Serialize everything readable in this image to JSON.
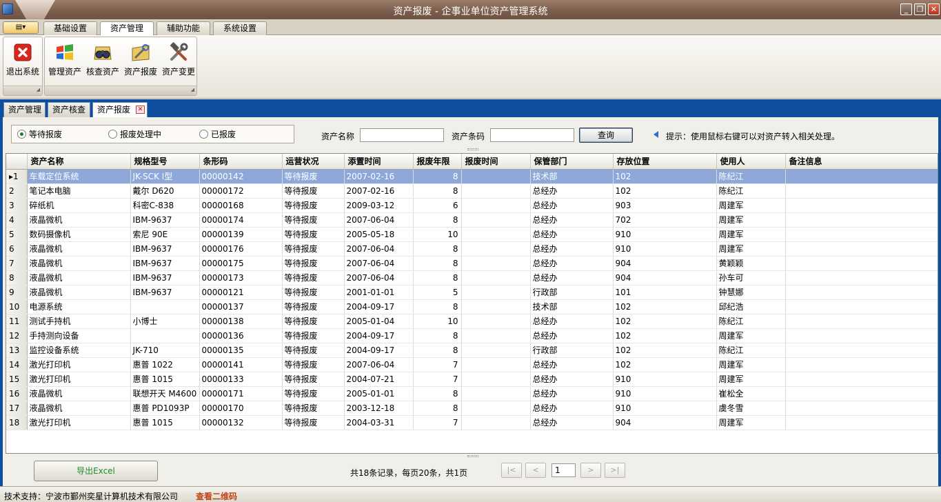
{
  "window": {
    "title": "资产报废 - 企事业单位资产管理系统"
  },
  "ribbon": {
    "menu_glyph": "▤▾",
    "tabs": [
      "基础设置",
      "资产管理",
      "辅助功能",
      "系统设置"
    ],
    "buttons": {
      "exit": "退出系统",
      "manage": "管理资产",
      "check": "核查资产",
      "scrap": "资产报废",
      "change": "资产变更"
    }
  },
  "doc_tabs": [
    "资产管理",
    "资产核查",
    "资产报废"
  ],
  "filter": {
    "radio_waiting": "等待报废",
    "radio_processing": "报废处理中",
    "radio_done": "已报废",
    "selected": "等待报废",
    "name_label": "资产名称",
    "name_value": "",
    "barcode_label": "资产条码",
    "barcode_value": "",
    "query_button": "查询",
    "hint": "提示：使用鼠标右键可以对资产转入相关处理。"
  },
  "grid": {
    "columns": [
      "资产名称",
      "规格型号",
      "条形码",
      "运营状况",
      "添置时间",
      "报废年限",
      "报废时间",
      "保管部门",
      "存放位置",
      "使用人",
      "备注信息"
    ],
    "selected_row": 1,
    "rows": [
      [
        "1",
        "车载定位系统",
        "JK-SCK Ⅰ型",
        "00000142",
        "等待报废",
        "2007-02-16",
        "8",
        "",
        "技术部",
        "102",
        "陈纪江",
        ""
      ],
      [
        "2",
        "笔记本电脑",
        "戴尔 D620",
        "00000172",
        "等待报废",
        "2007-02-16",
        "8",
        "",
        "总经办",
        "102",
        "陈纪江",
        ""
      ],
      [
        "3",
        "碎纸机",
        "科密C-838",
        "00000168",
        "等待报废",
        "2009-03-12",
        "6",
        "",
        "总经办",
        "903",
        "周建军",
        ""
      ],
      [
        "4",
        "液晶微机",
        "IBM-9637",
        "00000174",
        "等待报废",
        "2007-06-04",
        "8",
        "",
        "总经办",
        "702",
        "周建军",
        ""
      ],
      [
        "5",
        "数码摄像机",
        "索尼 90E",
        "00000139",
        "等待报废",
        "2005-05-18",
        "10",
        "",
        "总经办",
        "910",
        "周建军",
        ""
      ],
      [
        "6",
        "液晶微机",
        "IBM-9637",
        "00000176",
        "等待报废",
        "2007-06-04",
        "8",
        "",
        "总经办",
        "910",
        "周建军",
        ""
      ],
      [
        "7",
        "液晶微机",
        "IBM-9637",
        "00000175",
        "等待报废",
        "2007-06-04",
        "8",
        "",
        "总经办",
        "904",
        "黄颖颖",
        ""
      ],
      [
        "8",
        "液晶微机",
        "IBM-9637",
        "00000173",
        "等待报废",
        "2007-06-04",
        "8",
        "",
        "总经办",
        "904",
        "孙车可",
        ""
      ],
      [
        "9",
        "液晶微机",
        "IBM-9637",
        "00000121",
        "等待报废",
        "2001-01-01",
        "5",
        "",
        "行政部",
        "101",
        "钟慧娜",
        ""
      ],
      [
        "10",
        "电源系统",
        "",
        "00000137",
        "等待报废",
        "2004-09-17",
        "8",
        "",
        "技术部",
        "102",
        "邱纪浩",
        ""
      ],
      [
        "11",
        "测试手持机",
        "小博士",
        "00000138",
        "等待报废",
        "2005-01-04",
        "10",
        "",
        "总经办",
        "102",
        "陈纪江",
        ""
      ],
      [
        "12",
        "手持测向设备",
        "",
        "00000136",
        "等待报废",
        "2004-09-17",
        "8",
        "",
        "总经办",
        "102",
        "周建军",
        ""
      ],
      [
        "13",
        "监控设备系统",
        "JK-710",
        "00000135",
        "等待报废",
        "2004-09-17",
        "8",
        "",
        "行政部",
        "102",
        "陈纪江",
        ""
      ],
      [
        "14",
        "激光打印机",
        "惠普 1022",
        "00000141",
        "等待报废",
        "2007-06-04",
        "7",
        "",
        "总经办",
        "102",
        "周建军",
        ""
      ],
      [
        "15",
        "激光打印机",
        "惠普 1015",
        "00000133",
        "等待报废",
        "2004-07-21",
        "7",
        "",
        "总经办",
        "910",
        "周建军",
        ""
      ],
      [
        "16",
        "液晶微机",
        "联想开天 M4600",
        "00000171",
        "等待报废",
        "2005-01-01",
        "8",
        "",
        "总经办",
        "910",
        "崔松全",
        ""
      ],
      [
        "17",
        "液晶微机",
        "惠普 PD1093P",
        "00000170",
        "等待报废",
        "2003-12-18",
        "8",
        "",
        "总经办",
        "910",
        "虞冬雪",
        ""
      ],
      [
        "18",
        "激光打印机",
        "惠普 1015",
        "00000132",
        "等待报废",
        "2004-03-31",
        "7",
        "",
        "总经办",
        "904",
        "周建军",
        ""
      ]
    ]
  },
  "footer": {
    "export_button": "导出Excel",
    "page_info": "共18条记录，每页20条，共1页",
    "first": "|<",
    "prev": "<",
    "page": "1",
    "next": ">",
    "last": ">|"
  },
  "status": {
    "support": "技术支持：宁波市鄞州奕星计算机技术有限公司",
    "qr": "查看二维码"
  }
}
